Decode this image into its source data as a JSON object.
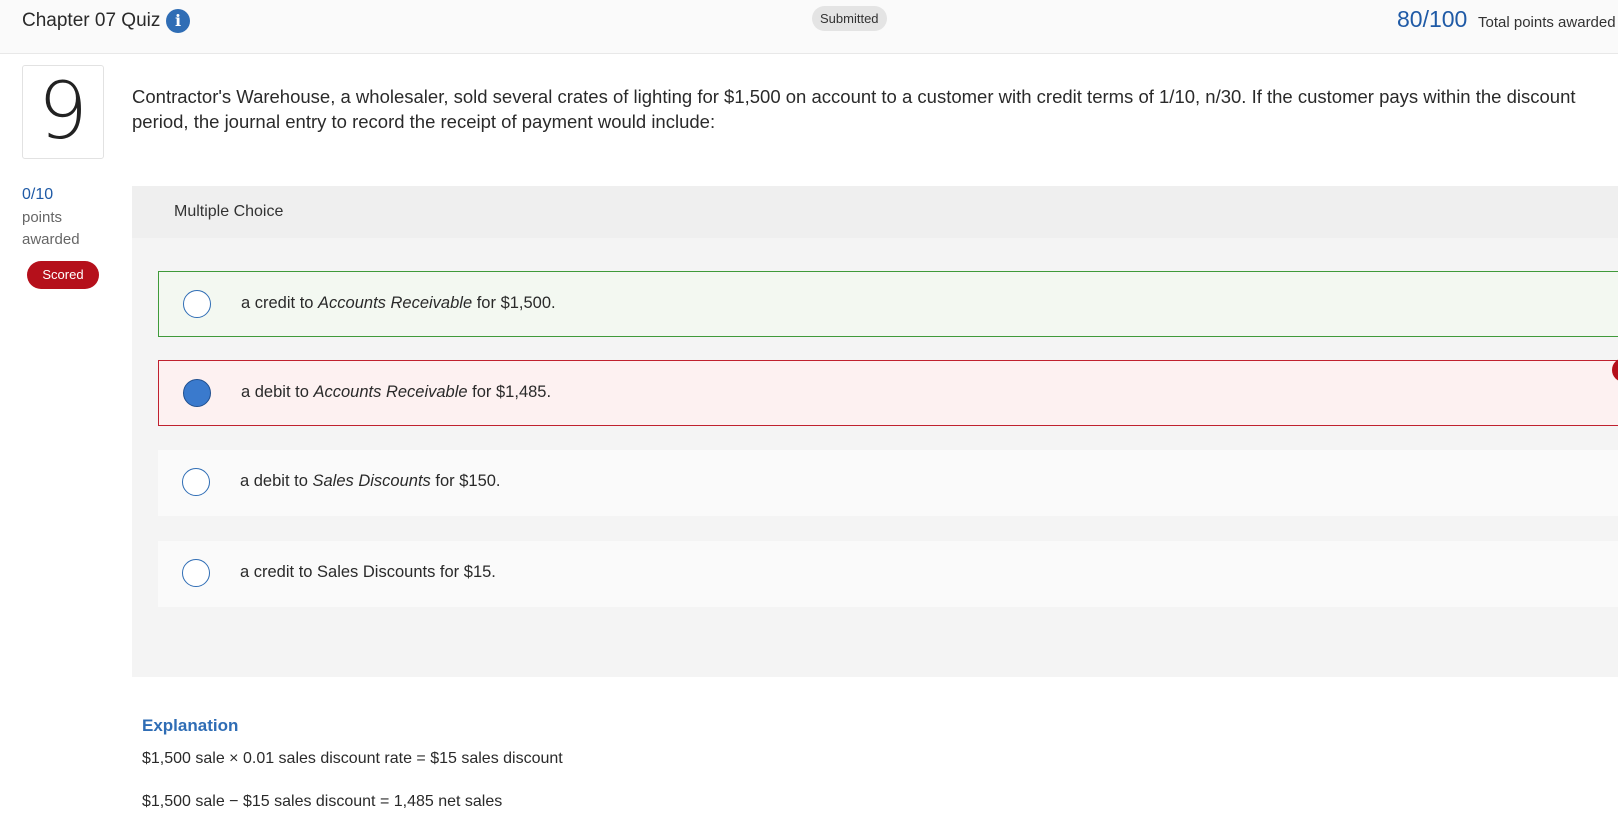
{
  "header": {
    "title": "Chapter 07 Quiz",
    "info_icon": "info-icon",
    "status": "Submitted",
    "total_score": "80/100",
    "total_label": "Total points awarded"
  },
  "question": {
    "number": "9",
    "text": "Contractor's Warehouse, a wholesaler, sold several crates of lighting for $1,500 on account to a customer with credit terms of 1/10, n/30. If the customer pays within the discount period, the journal entry to record the receipt of payment would include:",
    "score": "0/10",
    "score_label_line1": "points",
    "score_label_line2": "awarded",
    "scored_badge": "Scored"
  },
  "choices_panel": {
    "type_label": "Multiple Choice",
    "choices": [
      {
        "pre": "a credit to ",
        "em": "Accounts Receivable",
        "post": " for $1,500.",
        "state": "correct",
        "selected": false
      },
      {
        "pre": "a debit to ",
        "em": "Accounts Receivable",
        "post": " for $1,485.",
        "state": "incorrect",
        "selected": true
      },
      {
        "pre": "a debit to ",
        "em": "Sales Discounts",
        "post": " for $150.",
        "state": "neutral",
        "selected": false
      },
      {
        "pre": "a credit to Sales Discounts for $15.",
        "em": "",
        "post": "",
        "state": "neutral",
        "selected": false
      }
    ]
  },
  "explanation": {
    "title": "Explanation",
    "line1": "$1,500 sale × 0.01 sales discount rate = $15 sales discount",
    "line2": "$1,500 sale − $15 sales discount = 1,485 net sales"
  },
  "colors": {
    "accent": "#2f6db5",
    "score_blue": "#1f5aa6",
    "correct_border": "#3f9a3a",
    "incorrect_border": "#c0212f",
    "badge_red": "#b5101b"
  }
}
